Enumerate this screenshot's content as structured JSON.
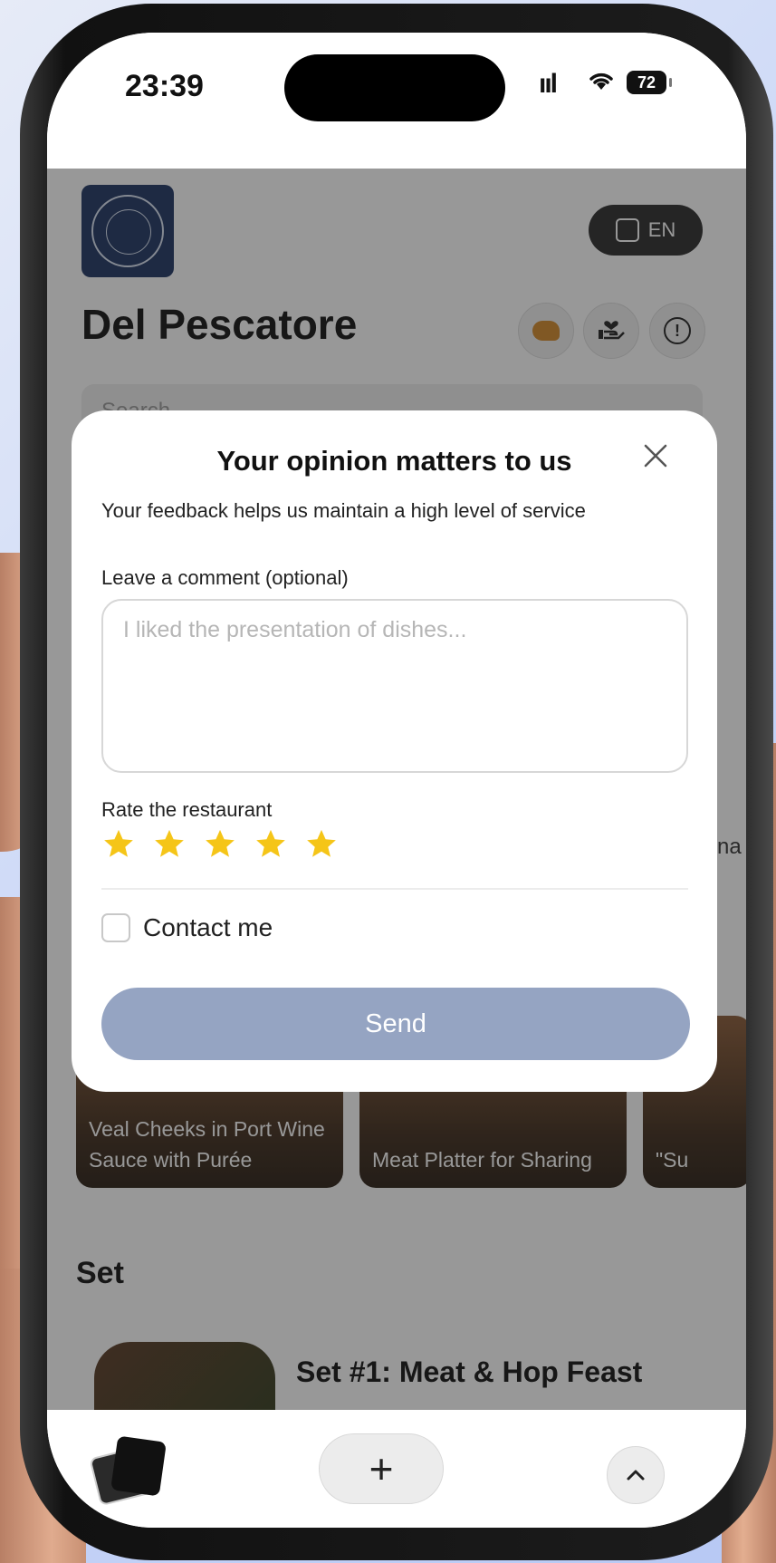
{
  "status_bar": {
    "time": "23:39",
    "battery": "72"
  },
  "header": {
    "language": "EN",
    "restaurant_name": "Del Pescatore"
  },
  "search": {
    "placeholder": "Search"
  },
  "background": {
    "side_tab_fragment": "na",
    "dishes": [
      {
        "name": "Veal Cheeks in Port Wine Sauce with Purée"
      },
      {
        "name": "Meat Platter for Sharing"
      },
      {
        "name": "\"Su"
      }
    ],
    "section_title": "Set",
    "set_title": "Set #1: Meat & Hop Feast"
  },
  "modal": {
    "title": "Your opinion matters to us",
    "subtitle": "Your feedback helps us maintain a high level of service",
    "comment_label": "Leave a comment (optional)",
    "comment_placeholder": "I liked the presentation of dishes...",
    "comment_value": "",
    "rate_label": "Rate the restaurant",
    "rating": 5,
    "rating_max": 5,
    "contact_label": "Contact me",
    "contact_checked": false,
    "send_label": "Send"
  },
  "bottom_bar": {
    "add_label": "+"
  },
  "colors": {
    "star": "#f5c518",
    "send_button": "#95a4c2",
    "logo": "#1e3563",
    "overlay": "rgba(30,30,30,0.46)"
  },
  "icons": [
    "close-icon",
    "star-icon",
    "chevron-up-icon",
    "plus-icon",
    "info-icon",
    "cookie-icon",
    "hand-heart-icon",
    "translate-icon"
  ]
}
